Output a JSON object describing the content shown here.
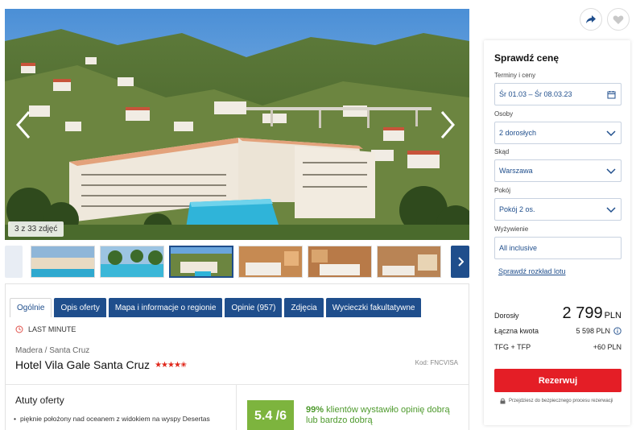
{
  "gallery": {
    "counter": "3 z 33 zdjęć"
  },
  "tabs": [
    {
      "label": "Ogólnie"
    },
    {
      "label": "Opis oferty"
    },
    {
      "label": "Mapa i informacje o regionie"
    },
    {
      "label": "Opinie (957)"
    },
    {
      "label": "Zdjęcia"
    },
    {
      "label": "Wycieczki fakultatywne"
    }
  ],
  "offer": {
    "badge": "LAST MINUTE",
    "region": "Madera / Santa Cruz",
    "hotel_name": "Hotel Vila Gale Santa Cruz",
    "stars": "★★★★✬",
    "code": "Kod: FNCVISA",
    "features_title": "Atuty oferty",
    "feature_1": "pięknie położony nad oceanem z widokiem na wyspy Desertas",
    "rating": "5.4 /6",
    "rating_pct": "99%",
    "rating_text": "klientów wystawiło opinię dobrą lub bardzo dobrą"
  },
  "booking": {
    "title": "Sprawdź cenę",
    "dates_label": "Terminy i ceny",
    "dates_value": "Śr 01.03 – Śr 08.03.23",
    "persons_label": "Osoby",
    "persons_value": "2 dorosłych",
    "from_label": "Skąd",
    "from_value": "Warszawa",
    "room_label": "Pokój",
    "room_value": "Pokój 2 os.",
    "board_label": "Wyżywienie",
    "board_value": "All inclusive",
    "flight_link": "Sprawdź rozkład lotu",
    "adult_label": "Dorosły",
    "adult_price": "2 799",
    "currency": "PLN",
    "total_label": "Łączna kwota",
    "total_value": "5 598 PLN",
    "tfg_label": "TFG + TFP",
    "tfg_value": "+60 PLN",
    "reserve_label": "Rezerwuj",
    "secure_text": "Przejdziesz do bezpiecznego procesu rezerwacji"
  },
  "colors": {
    "brand": "#1f4e8c",
    "reserve": "#e41e26",
    "rating": "#7db43e"
  }
}
